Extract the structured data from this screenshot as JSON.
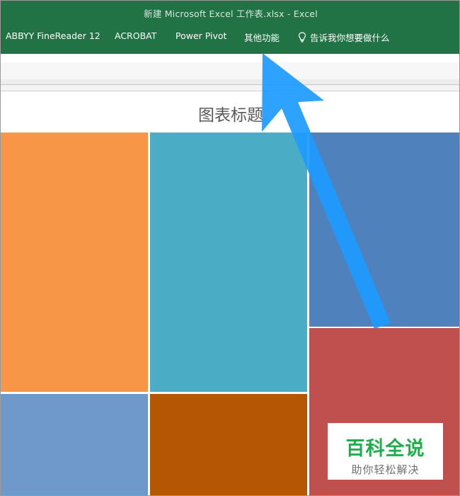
{
  "window": {
    "title": "新建 Microsoft Excel 工作表.xlsx  -  Excel"
  },
  "ribbon": {
    "tabs": [
      {
        "label": "ABBYY FineReader 12"
      },
      {
        "label": "ACROBAT"
      },
      {
        "label": "Power Pivot"
      },
      {
        "label": "其他功能"
      }
    ],
    "tell_me": {
      "icon": "lightbulb-icon",
      "label": "告诉我你想要做什么"
    }
  },
  "chart": {
    "title": "图表标题",
    "type": "treemap",
    "tile_colors": {
      "orange": "#f79646",
      "teal": "#4bacc6",
      "steel_blue": "#4f81bd",
      "red": "#c0504d",
      "light_blue": "#6f98cb",
      "brown": "#b45604"
    }
  },
  "annotation": {
    "arrow_color": "#1e9bff",
    "icon": "pointer-arrow-icon"
  },
  "watermark": {
    "main_text": "百科全说",
    "sub_text": "助你轻松解决",
    "main_color": "#1fae4b"
  },
  "theme": {
    "excel_green": "#217346"
  }
}
